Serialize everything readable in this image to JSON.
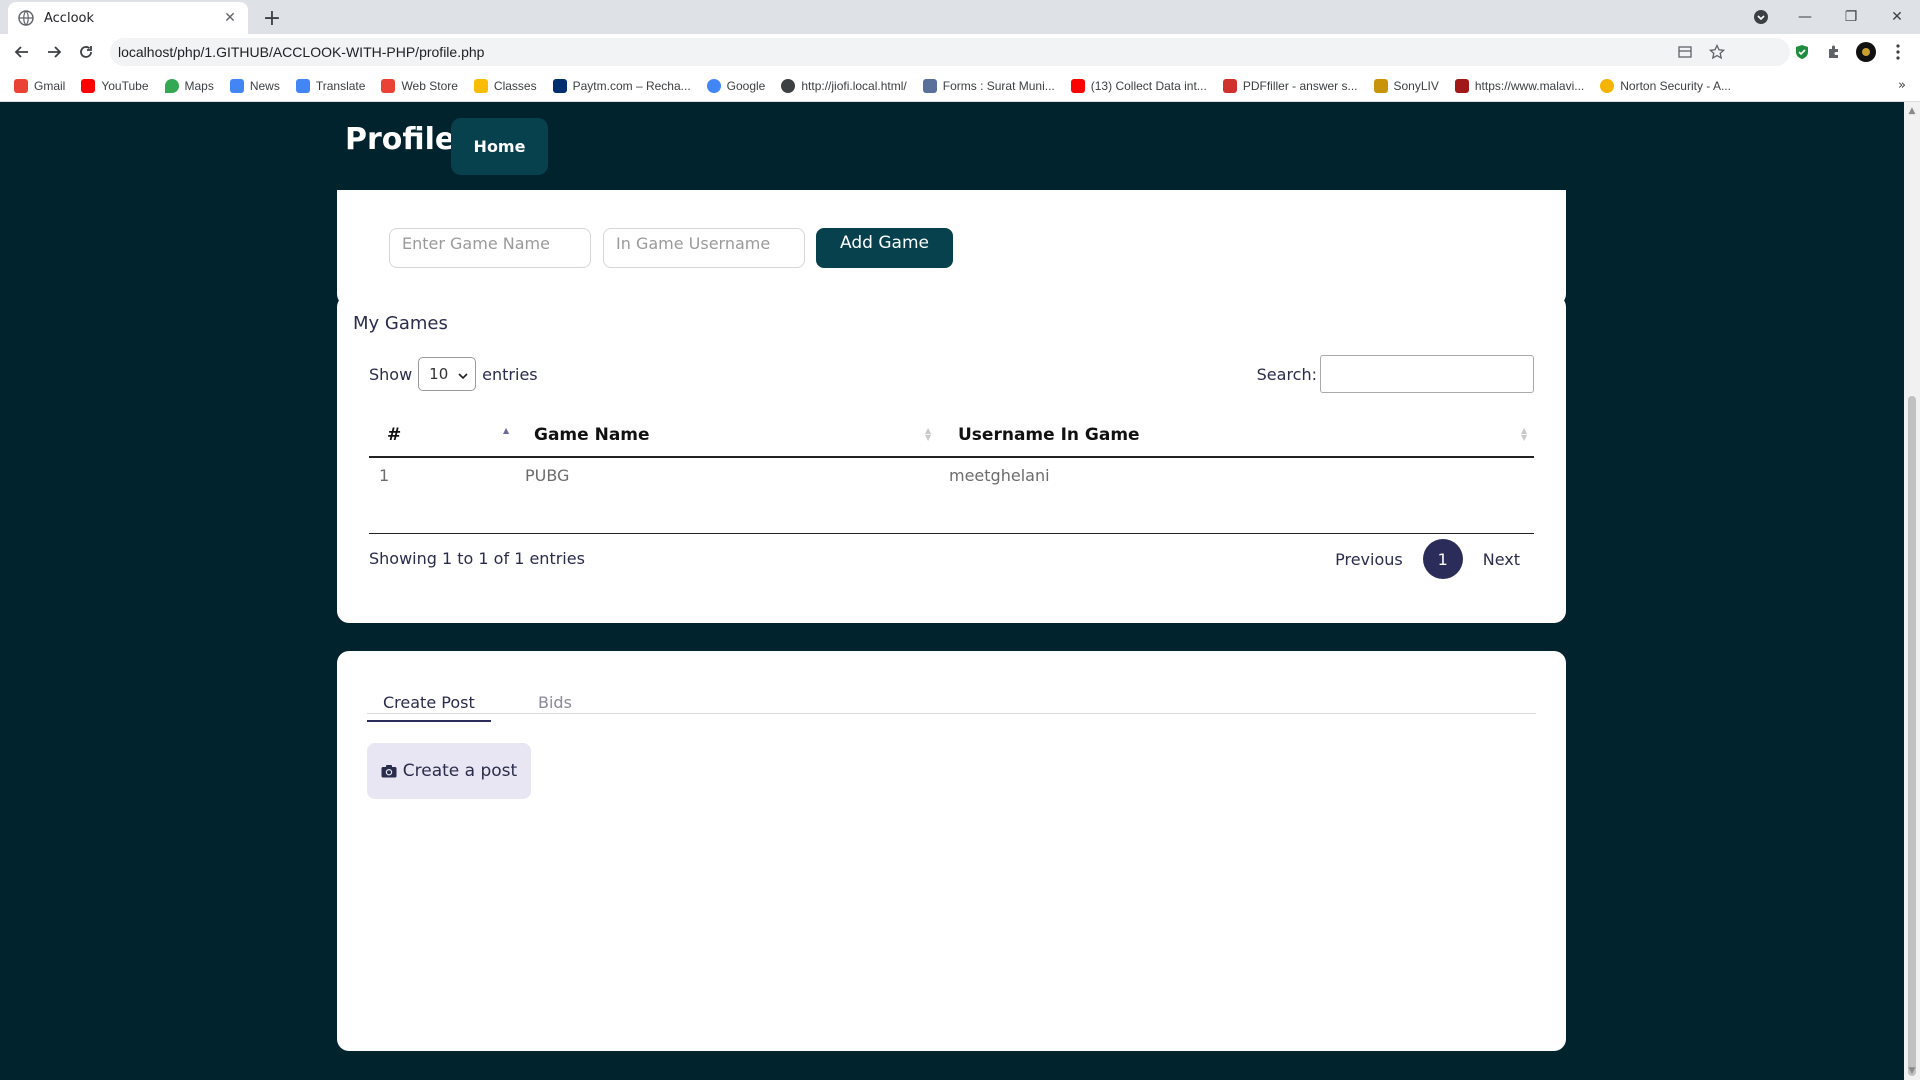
{
  "browser": {
    "tab_title": "Acclook",
    "new_tab": "+",
    "url": "localhost/php/1.GITHUB/ACCLOOK-WITH-PHP/profile.php",
    "bookmarks": [
      {
        "label": "Gmail",
        "color": "#ea4335"
      },
      {
        "label": "YouTube",
        "color": "#ff0000"
      },
      {
        "label": "Maps",
        "color": "#34a853"
      },
      {
        "label": "News",
        "color": "#4285f4"
      },
      {
        "label": "Translate",
        "color": "#4285f4"
      },
      {
        "label": "Web Store",
        "color": "#ea4335"
      },
      {
        "label": "Classes",
        "color": "#fbbc04"
      },
      {
        "label": "Paytm.com – Recha...",
        "color": "#002e6e"
      },
      {
        "label": "Google",
        "color": "#4285f4"
      },
      {
        "label": "http://jiofi.local.html/",
        "color": "#3c4043"
      },
      {
        "label": "Forms : Surat Muni...",
        "color": "#5a6f9a"
      },
      {
        "label": "(13) Collect Data int...",
        "color": "#ff0000"
      },
      {
        "label": "PDFfiller - answer s...",
        "color": "#d0312d"
      },
      {
        "label": "SonyLIV",
        "color": "#c8940a"
      },
      {
        "label": "https://www.malavi...",
        "color": "#a01818"
      },
      {
        "label": "Norton Security - A...",
        "color": "#f4b400"
      }
    ],
    "bookmarks_more": "»"
  },
  "header": {
    "brand": "Profile",
    "home_label": "Home"
  },
  "add_game_form": {
    "game_name_placeholder": "Enter Game Name",
    "username_placeholder": "In Game Username",
    "add_label": "Add Game"
  },
  "games": {
    "title": "My Games",
    "show_label": "Show",
    "page_size": "10",
    "entries_label": "entries",
    "search_label": "Search:",
    "columns": [
      "#",
      "Game Name",
      "Username In Game"
    ],
    "rows": [
      {
        "index": "1",
        "game": "PUBG",
        "username": "meetghelani"
      }
    ],
    "info": "Showing 1 to 1 of 1 entries",
    "previous_label": "Previous",
    "current_page": "1",
    "next_label": "Next"
  },
  "posts": {
    "tabs": [
      "Create Post",
      "Bids"
    ],
    "create_label": "Create a post"
  },
  "colors": {
    "page_bg": "#01232d",
    "button_dark": "#07414e",
    "accent": "#2c2c5a"
  }
}
